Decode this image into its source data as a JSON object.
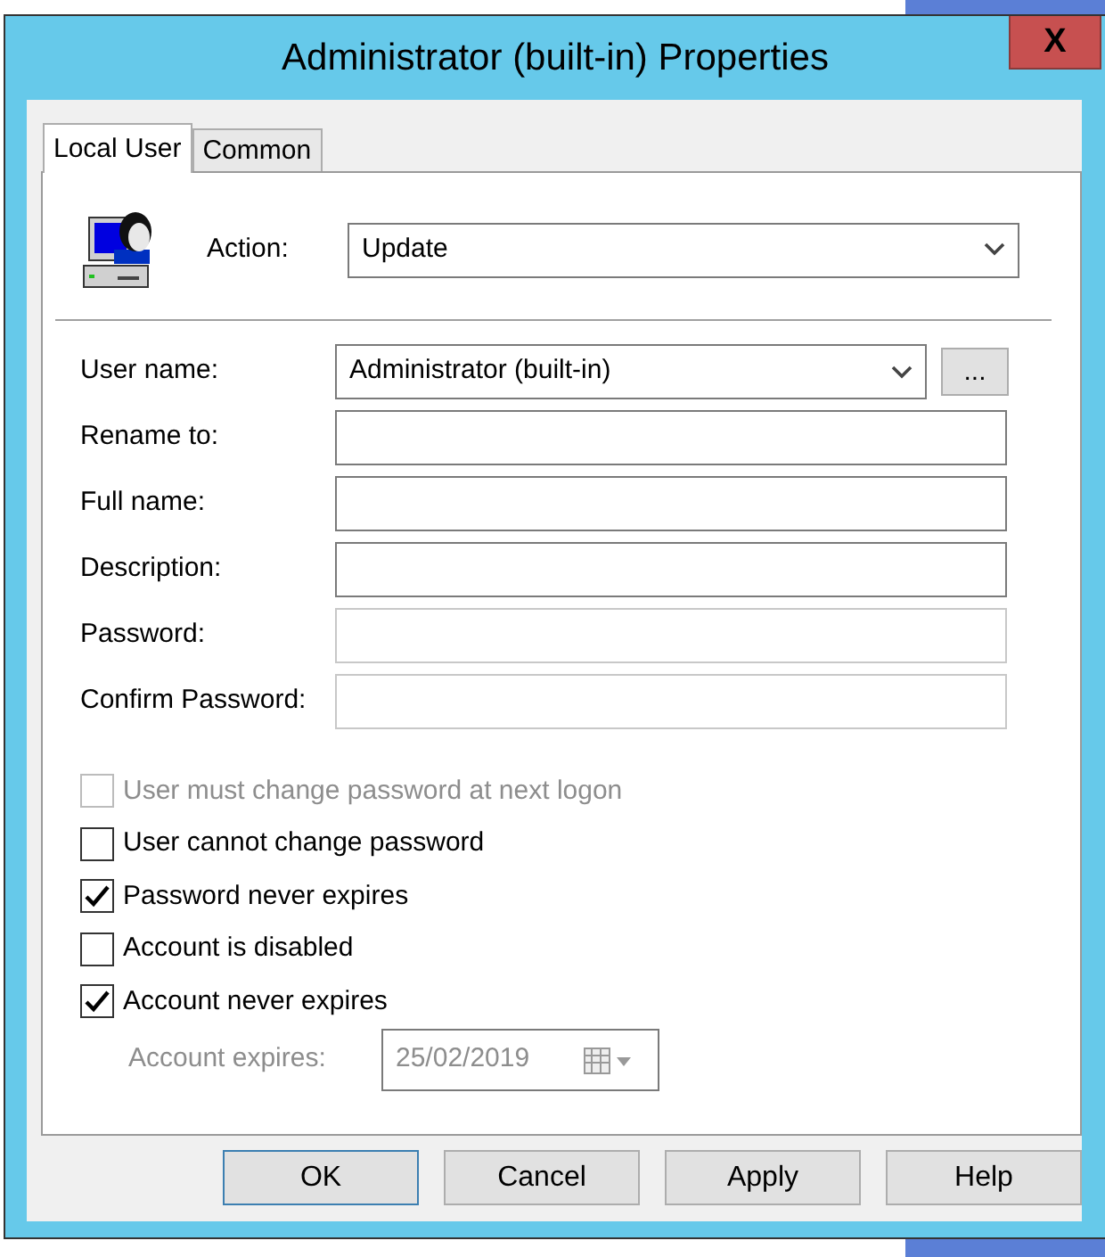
{
  "window": {
    "title": "Administrator (built-in) Properties",
    "close": "X"
  },
  "tabs": [
    {
      "label": "Local User",
      "selected": true
    },
    {
      "label": "Common",
      "selected": false
    }
  ],
  "action": {
    "label": "Action:",
    "value": "Update"
  },
  "fields": [
    {
      "kind": "combo",
      "label": "User name:",
      "value": "Administrator (built-in)",
      "browse": "...",
      "disabled": false
    },
    {
      "kind": "text",
      "label": "Rename to:",
      "disabled": false
    },
    {
      "kind": "text",
      "label": "Full name:",
      "disabled": false
    },
    {
      "kind": "text",
      "label": "Description:",
      "disabled": false
    },
    {
      "kind": "text",
      "label": "Password:",
      "disabled": true
    },
    {
      "kind": "text",
      "label": "Confirm Password:",
      "disabled": true
    }
  ],
  "options": [
    {
      "label": "User must change password at next logon",
      "checked": false,
      "disabled": true
    },
    {
      "label": "User cannot change password",
      "checked": false,
      "disabled": false
    },
    {
      "label": "Password never expires",
      "checked": true,
      "disabled": false
    },
    {
      "label": "Account is disabled",
      "checked": false,
      "disabled": false
    },
    {
      "label": "Account never expires",
      "checked": true,
      "disabled": false
    }
  ],
  "expires": {
    "label": "Account expires:",
    "value": "25/02/2019",
    "disabled": true
  },
  "buttons": [
    {
      "label": "OK",
      "default": true
    },
    {
      "label": "Cancel",
      "default": false
    },
    {
      "label": "Apply",
      "default": false
    },
    {
      "label": "Help",
      "default": false
    }
  ]
}
